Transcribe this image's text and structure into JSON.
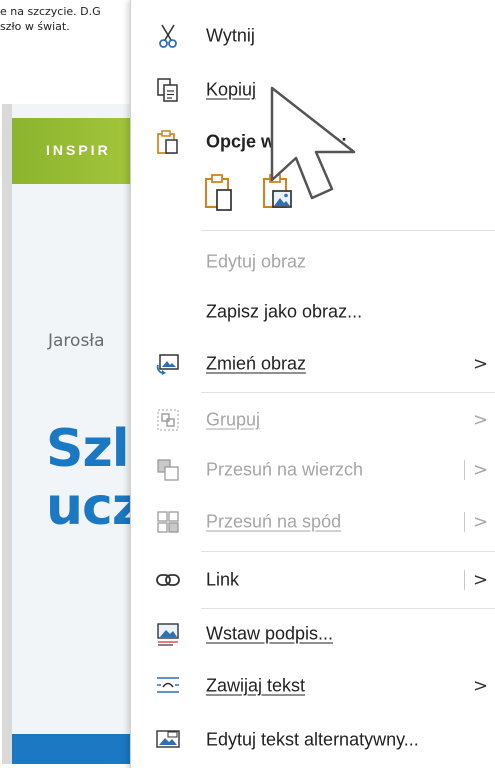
{
  "document": {
    "line1": "e na szczycie. D.G",
    "line2": "szło w świat.",
    "book": {
      "series": "INSPIR",
      "author": "Jarosła",
      "title_line1": "Szl",
      "title_line2": "ucz"
    }
  },
  "context_menu": {
    "cut": "Wytnij",
    "copy": "Kopiuj",
    "paste_options": "Opcje wklejania:",
    "edit_image": "Edytuj obraz",
    "save_as_image": "Zapisz jako obraz...",
    "change_image": "Zmień obraz",
    "group": "Grupuj",
    "bring_to_front": "Przesuń na wierzch",
    "send_to_back": "Przesuń na spód",
    "link": "Link",
    "insert_caption": "Wstaw podpis...",
    "wrap_text": "Zawijaj tekst",
    "edit_alt_text": "Edytuj tekst alternatywny...",
    "submenu_arrow": ">"
  },
  "colors": {
    "accent_orange": "#d2831f",
    "accent_blue": "#2e6fb5",
    "disabled_text": "#a6a6a6",
    "book_title_blue": "#1b78c3",
    "book_band_green": "#95bb32"
  }
}
